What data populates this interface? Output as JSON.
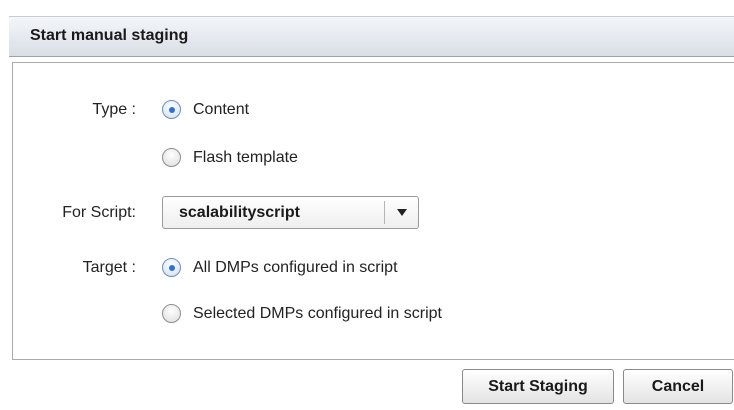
{
  "dialog": {
    "title": "Start manual staging"
  },
  "form": {
    "type_label": "Type :",
    "type_options": [
      {
        "label": "Content",
        "checked": true
      },
      {
        "label": "Flash template",
        "checked": false
      }
    ],
    "script_label": "For Script:",
    "script_value": "scalabilityscript",
    "target_label": "Target :",
    "target_options": [
      {
        "label": "All DMPs configured in script",
        "checked": true
      },
      {
        "label": "Selected DMPs configured in script",
        "checked": false
      }
    ]
  },
  "buttons": {
    "start_label": "Start Staging",
    "cancel_label": "Cancel"
  },
  "colors": {
    "radio_selected": "#2f6fd6",
    "titlebar_top": "#f4f6f9",
    "titlebar_bottom": "#d9dee6"
  }
}
